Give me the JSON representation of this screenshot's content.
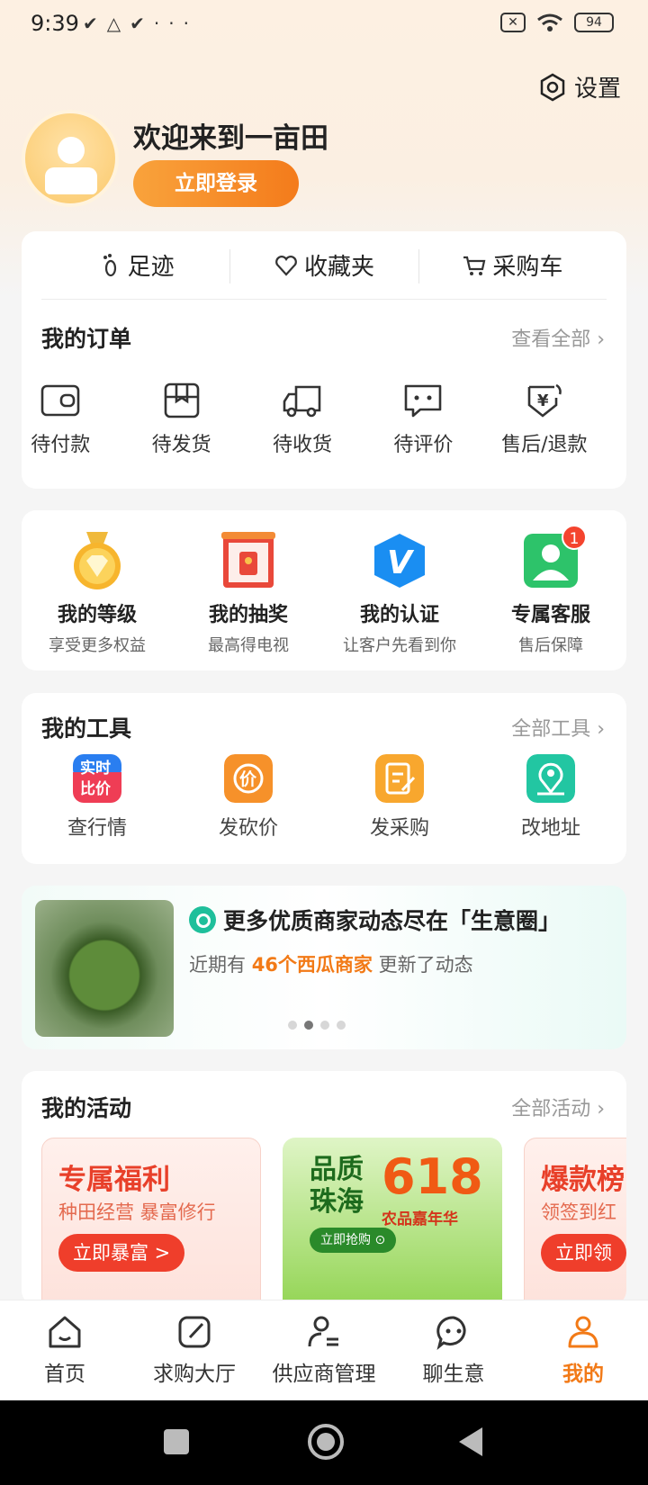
{
  "status_bar": {
    "time": "9:39",
    "battery": "94"
  },
  "header": {
    "settings_label": "设置"
  },
  "profile": {
    "welcome": "欢迎来到一亩田",
    "login_label": "立即登录"
  },
  "quick_links": [
    {
      "icon": "footprint-icon",
      "label": "足迹"
    },
    {
      "icon": "heart-icon",
      "label": "收藏夹"
    },
    {
      "icon": "cart-icon",
      "label": "采购车"
    }
  ],
  "orders": {
    "title": "我的订单",
    "more": "查看全部",
    "items": [
      {
        "icon": "wallet-icon",
        "label": "待付款"
      },
      {
        "icon": "package-icon",
        "label": "待发货"
      },
      {
        "icon": "truck-icon",
        "label": "待收货"
      },
      {
        "icon": "comment-icon",
        "label": "待评价"
      },
      {
        "icon": "refund-icon",
        "label": "售后/退款"
      }
    ]
  },
  "features": [
    {
      "icon": "medal-icon",
      "title": "我的等级",
      "sub": "享受更多权益"
    },
    {
      "icon": "lottery-icon",
      "title": "我的抽奖",
      "sub": "最高得电视"
    },
    {
      "icon": "verify-icon",
      "title": "我的认证",
      "sub": "让客户先看到你"
    },
    {
      "icon": "service-icon",
      "title": "专属客服",
      "sub": "售后保障",
      "badge": "1"
    }
  ],
  "tools": {
    "title": "我的工具",
    "more": "全部工具",
    "items": [
      {
        "icon": "price-compare-icon",
        "label": "查行情",
        "icon_text1": "实时",
        "icon_text2": "比价"
      },
      {
        "icon": "bargain-icon",
        "label": "发砍价",
        "icon_text1": "价"
      },
      {
        "icon": "purchase-icon",
        "label": "发采购"
      },
      {
        "icon": "location-icon",
        "label": "改地址"
      }
    ]
  },
  "banner": {
    "title": "更多优质商家动态尽在「生意圈」",
    "sub_prefix": "近期有",
    "sub_highlight": "46个西瓜商家",
    "sub_suffix": "更新了动态"
  },
  "activities": {
    "title": "我的活动",
    "more": "全部活动",
    "cards": [
      {
        "title": "专属福利",
        "sub": "种田经营 暴富修行",
        "button": "立即暴富 >"
      },
      {
        "title_top": "品质",
        "title_bottom": "珠海",
        "number": "618",
        "tag": "农品嘉年华",
        "button": "立即抢购 ⊙"
      },
      {
        "title": "爆款榜",
        "sub": "领签到红",
        "button": "立即领"
      }
    ]
  },
  "tabbar": [
    {
      "icon": "home-icon",
      "label": "首页",
      "active": false
    },
    {
      "icon": "edit-icon",
      "label": "求购大厅",
      "active": false
    },
    {
      "icon": "supplier-icon",
      "label": "供应商管理",
      "active": false
    },
    {
      "icon": "chat-icon",
      "label": "聊生意",
      "active": false
    },
    {
      "icon": "profile-icon",
      "label": "我的",
      "active": true
    }
  ],
  "colors": {
    "accent": "#f27a17",
    "badge": "#f4442e",
    "background": "#f5f5f5"
  }
}
